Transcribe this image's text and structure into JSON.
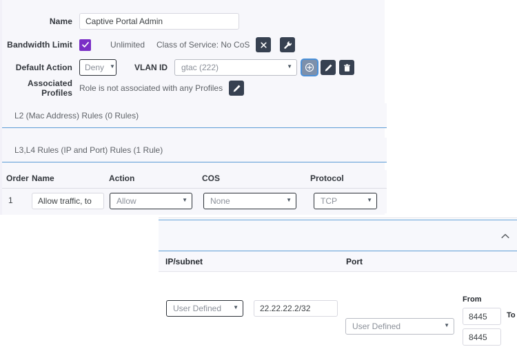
{
  "form": {
    "name": {
      "label": "Name",
      "value": "Captive Portal Admin"
    },
    "bandwidth": {
      "label": "Bandwidth Limit",
      "checkbox_checked": true,
      "checkbox_color": "#7A2EC6",
      "unlimited_text": "Unlimited",
      "cos_text": "Class of Service: No CoS",
      "clear_icon": "close-icon",
      "config_icon": "wrench-icon"
    },
    "default_action": {
      "label": "Default Action",
      "value": "Deny"
    },
    "vlan": {
      "label": "VLAN ID",
      "value": "gtac (222)",
      "add_icon": "plus-circle-icon",
      "edit_icon": "pencil-icon",
      "delete_icon": "trash-icon"
    },
    "associated_profiles": {
      "label": "Associated Profiles",
      "text": "Role is not associated with any Profiles",
      "edit_icon": "pencil-icon"
    }
  },
  "sections": {
    "l2": "L2 (Mac Address) Rules (0 Rules)",
    "l34": "L3,L4 Rules (IP and Port) Rules (1 Rule)"
  },
  "rules_table": {
    "headers": [
      "Order",
      "Name",
      "Action",
      "COS",
      "Protocol"
    ],
    "rows": [
      {
        "order": "1",
        "name": "Allow traffic, to",
        "action": "Allow",
        "cos": "None",
        "protocol": "TCP"
      }
    ]
  },
  "overlay": {
    "collapse_icon": "chevron-up-icon",
    "headers": [
      "IP/subnet",
      "Port"
    ],
    "ip": {
      "kind": "User Defined",
      "value": "22.22.22.2/32"
    },
    "port": {
      "kind": "User Defined",
      "from_label": "From",
      "to_label": "To",
      "from_value": "8445",
      "to_value": "8445"
    }
  },
  "colors": {
    "page_bg": "#ffffff",
    "panel_bg": "#f7f7fb",
    "accent_blue": "#5b9bd5",
    "checkbox_purple": "#7A2EC6",
    "icon_dark": "#374151",
    "focus_blue": "#4a90d9"
  }
}
